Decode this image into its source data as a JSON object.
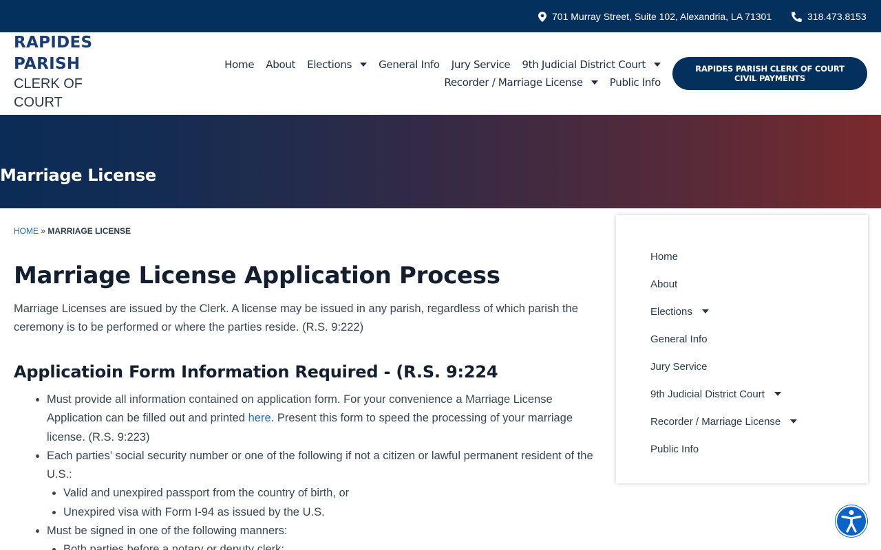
{
  "topbar": {
    "address": "701 Murray Street, Suite 102, Alexandria, LA 71301",
    "phone": "318.473.8153",
    "address_icon": "map-marker-icon",
    "phone_icon": "phone-icon"
  },
  "logo": {
    "line1": "RAPIDES",
    "line2": "PARISH",
    "line3": "CLERK OF",
    "line4": "COURT"
  },
  "nav": {
    "home": "Home",
    "about": "About",
    "elections": "Elections",
    "general_info": "General Info",
    "jury_service": "Jury Service",
    "district_court": "9th Judicial District Court",
    "recorder": "Recorder / Marriage License",
    "public_info": "Public Info"
  },
  "pay_button": "RAPIDES PARISH CLERK OF COURT CIVIL PAYMENTS",
  "hero": {
    "title": "Marriage License"
  },
  "breadcrumb": {
    "home": "HOME",
    "separator": "»",
    "current": "MARRIAGE LICENSE"
  },
  "content": {
    "heading": "Marriage License Application Process",
    "intro": "Marriage Licenses are issued by the Clerk. A license may be issued in any parish, regardless of which parish the ceremony is to be performed or where the parties reside. (R.S. 9:222)",
    "subheading": "Applicatioin Form Information Required - (R.S. 9:224",
    "item1_before": "Must provide all information contained on application form. For your convenience a Marriage License Application can be filled out and printed ",
    "item1_link": "here",
    "item1_after": ". Present this form to speed the processing of your marriage license. (R.S. 9:223)",
    "item2": "Each parties’ social security number or one of the following if not a citizen or lawful permanent resident of the U.S.:",
    "item2_sub1": "Valid and unexpired passport from the country of birth, or",
    "item2_sub2": "Unexpired visa with Form I-94 as issued by the U.S.",
    "item3": "Must be signed in one of the following manners:",
    "item3_sub1": "Both parties before a notary or deputy clerk;"
  },
  "sidebar": {
    "home": "Home",
    "about": "About",
    "elections": "Elections",
    "general_info": "General Info",
    "jury_service": "Jury Service",
    "district_court": "9th Judicial District Court",
    "recorder": "Recorder / Marriage License",
    "public_info": "Public Info"
  },
  "colors": {
    "topbar": "#04305e",
    "brand_blue": "#1a3c72",
    "link": "#1a6fc4",
    "hero_start": "#0a2c57",
    "hero_end": "#7a2a2c",
    "a11y": "#0b63c8"
  },
  "a11y_icon": "accessibility-icon"
}
